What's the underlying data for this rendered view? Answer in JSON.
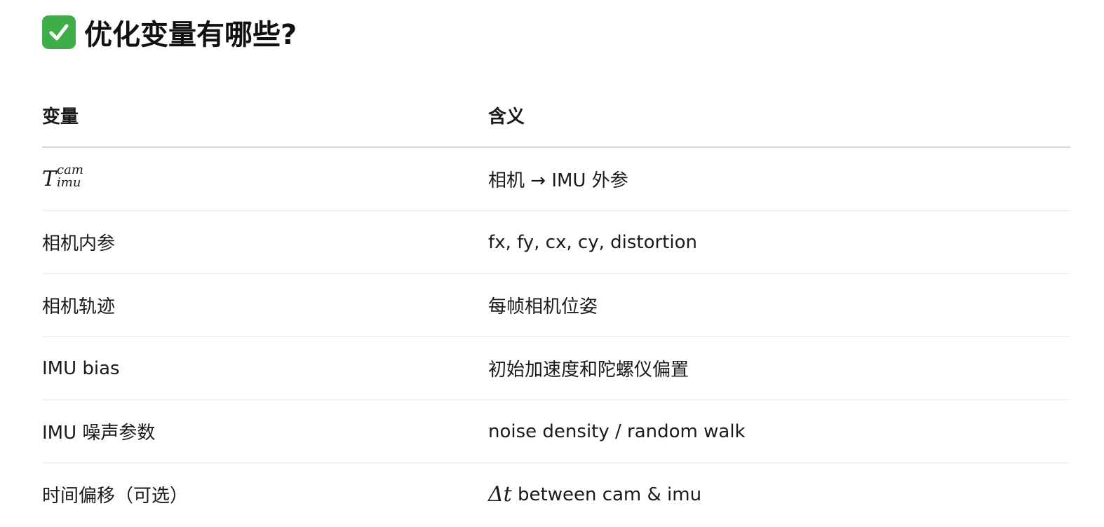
{
  "heading": {
    "icon": "check-mark-button-icon",
    "icon_color": "#3fae49",
    "text": "优化变量有哪些?"
  },
  "table": {
    "headers": [
      "变量",
      "含义"
    ],
    "rows": [
      {
        "variable": {
          "base": "T",
          "sup": "cam",
          "sub": "imu"
        },
        "meaning": "相机 → IMU 外参"
      },
      {
        "variable": "相机内参",
        "meaning": "fx, fy, cx, cy, distortion"
      },
      {
        "variable": "相机轨迹",
        "meaning": "每帧相机位姿"
      },
      {
        "variable": "IMU bias",
        "meaning": "初始加速度和陀螺仪偏置"
      },
      {
        "variable": "IMU 噪声参数",
        "meaning": "noise density / random walk"
      },
      {
        "variable": "时间偏移（可选）",
        "meaning": {
          "math": "Δt",
          "text": " between cam & imu"
        }
      }
    ]
  }
}
